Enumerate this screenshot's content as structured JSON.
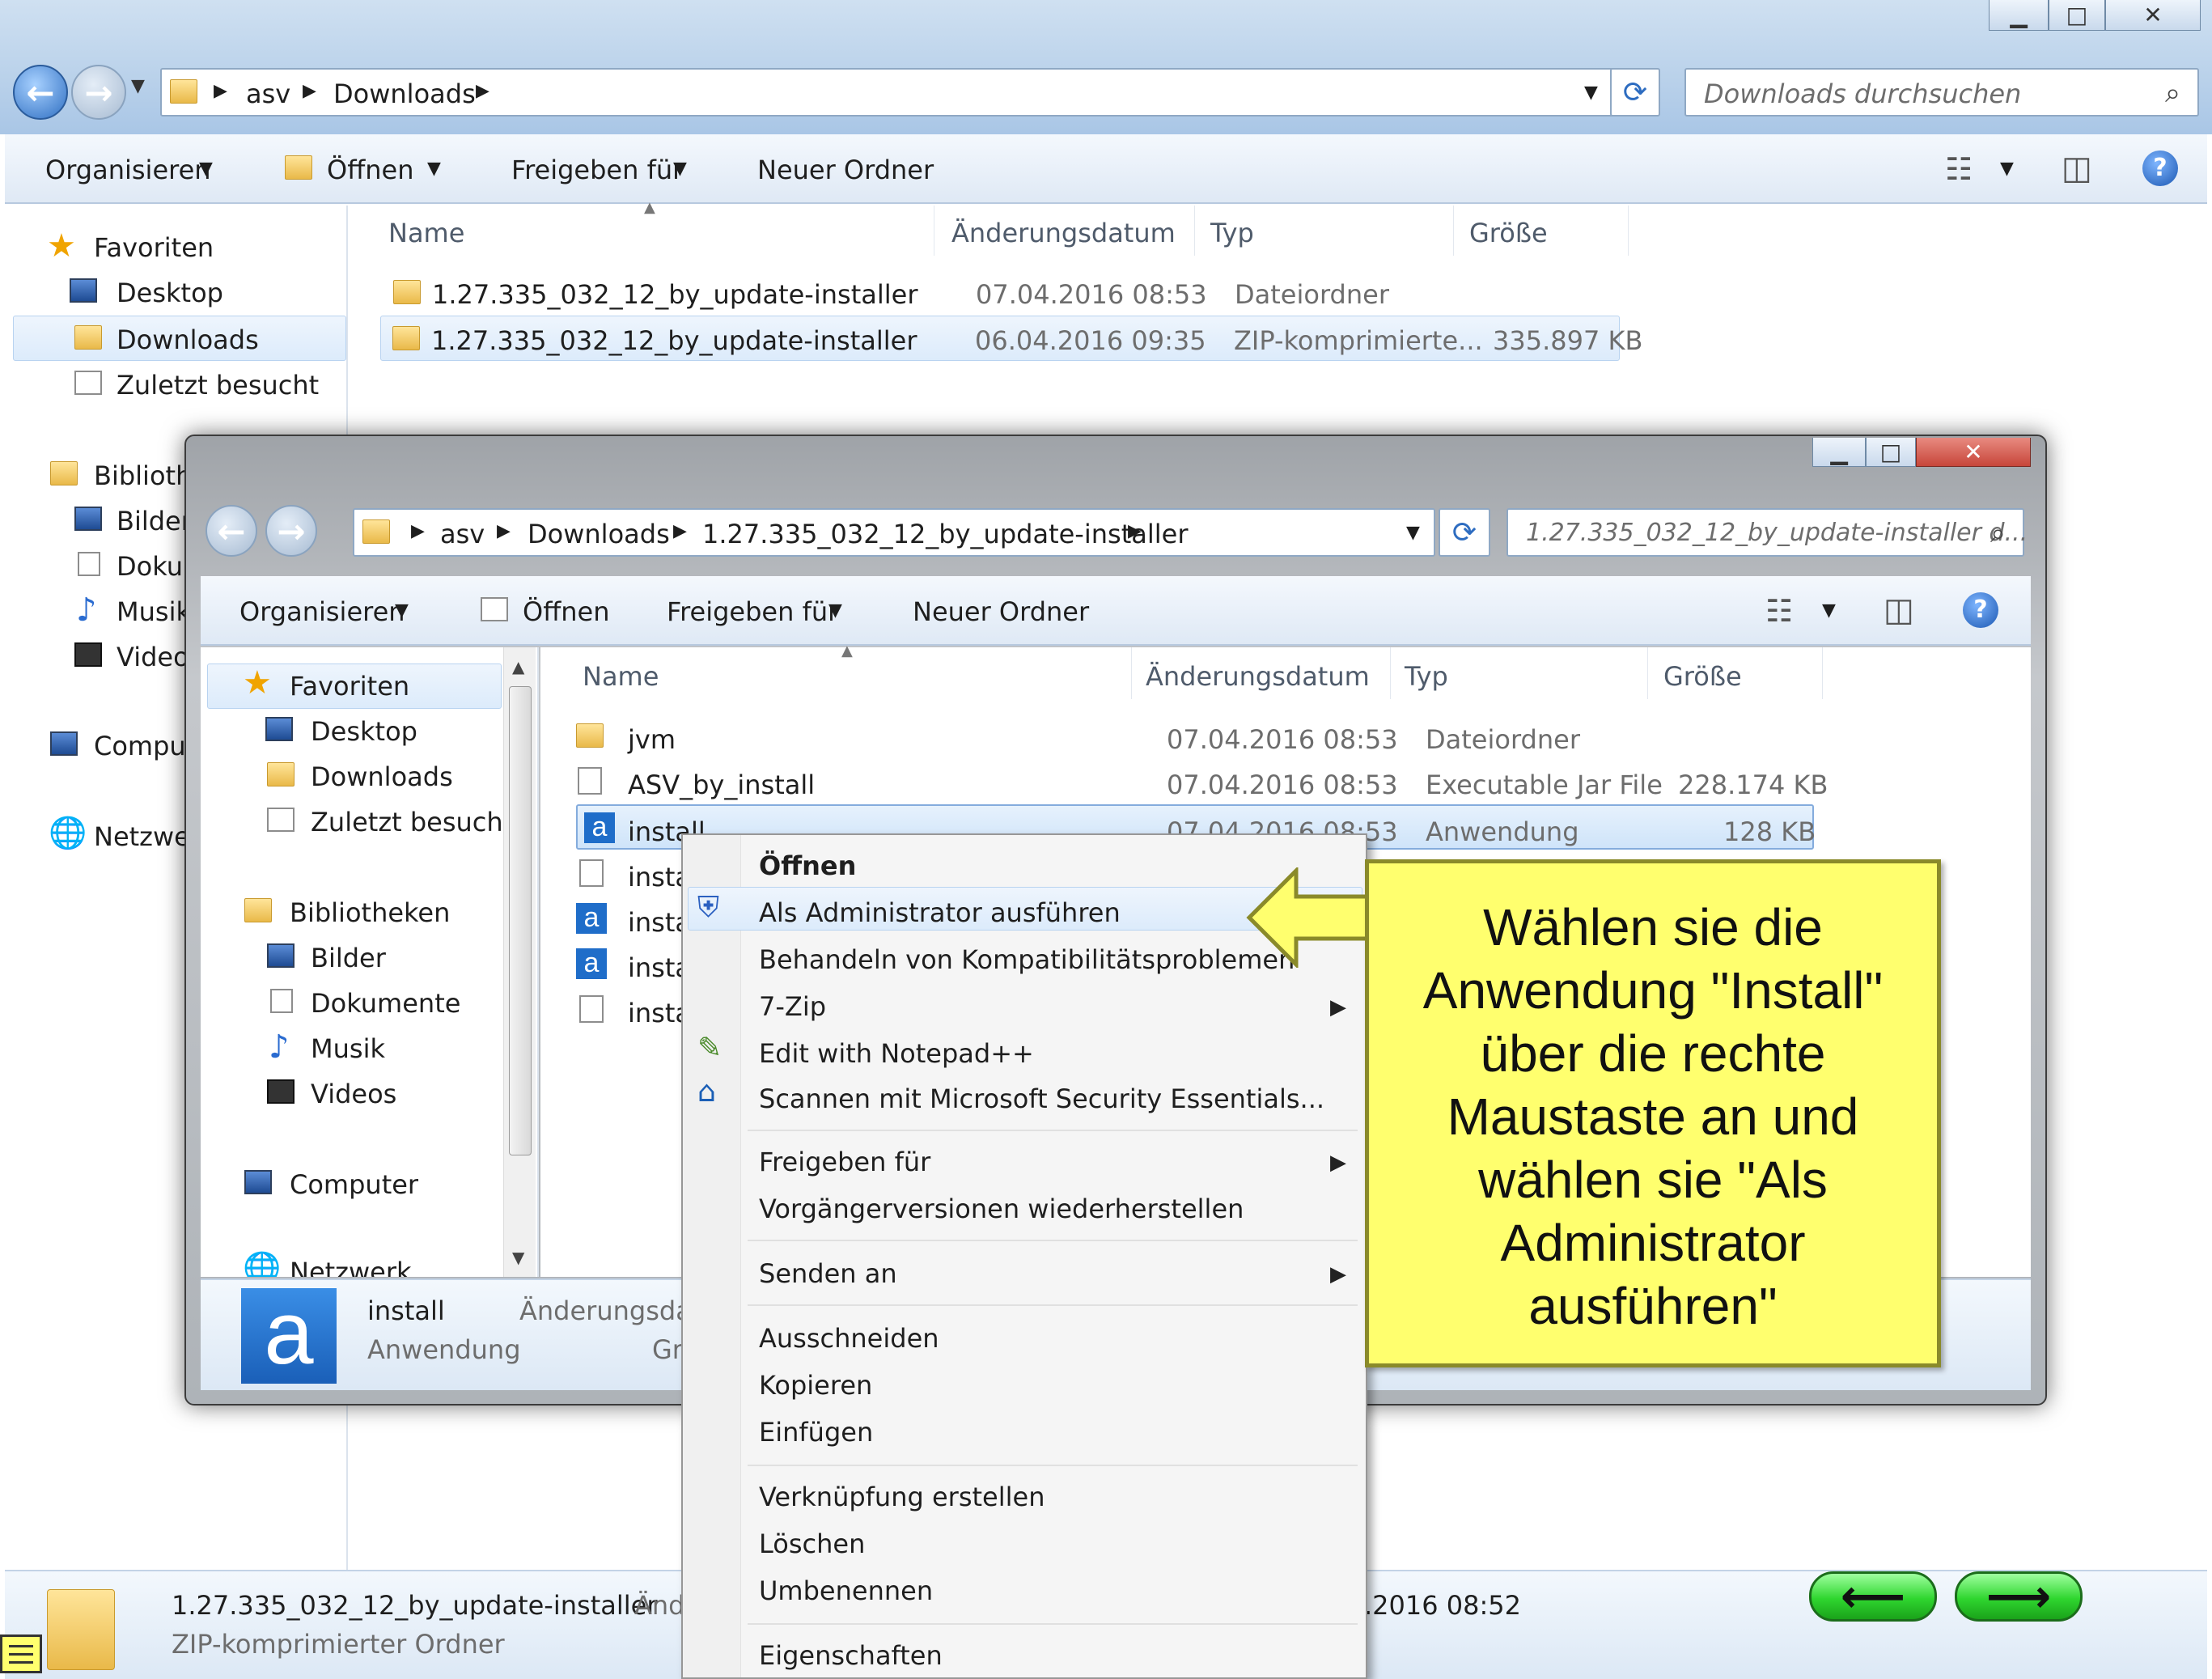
{
  "outer": {
    "breadcrumb": [
      "asv",
      "Downloads"
    ],
    "search_placeholder": "Downloads durchsuchen",
    "toolbar": {
      "organize": "Organisieren",
      "open": "Öffnen",
      "share": "Freigeben für",
      "new_folder": "Neuer Ordner"
    },
    "sidebar": {
      "favorites": "Favoriten",
      "desktop": "Desktop",
      "downloads": "Downloads",
      "recent": "Zuletzt besucht",
      "libraries": "Biblioth",
      "pictures": "Bilder",
      "documents": "Doku",
      "music": "Musik",
      "videos": "Video",
      "computer": "Compu",
      "network": "Netzwe"
    },
    "columns": {
      "name": "Name",
      "date": "Änderungsdatum",
      "type": "Typ",
      "size": "Größe"
    },
    "files": [
      {
        "name": "1.27.335_032_12_by_update-installer",
        "date": "07.04.2016 08:53",
        "type": "Dateiordner",
        "size": ""
      },
      {
        "name": "1.27.335_032_12_by_update-installer",
        "date": "06.04.2016 09:35",
        "type": "ZIP-komprimierte...",
        "size": "335.897 KB"
      }
    ],
    "details": {
      "name": "1.27.335_032_12_by_update-installer",
      "type": "ZIP-komprimierter Ordner",
      "date_label": "Änd",
      "date_value": ".2016 08:52"
    }
  },
  "inner": {
    "breadcrumb": [
      "asv",
      "Downloads",
      "1.27.335_032_12_by_update-installer"
    ],
    "search_placeholder": "1.27.335_032_12_by_update-installer d...",
    "toolbar": {
      "organize": "Organisieren",
      "open": "Öffnen",
      "share": "Freigeben für",
      "new_folder": "Neuer Ordner"
    },
    "sidebar": {
      "favorites": "Favoriten",
      "desktop": "Desktop",
      "downloads": "Downloads",
      "recent": "Zuletzt besucht",
      "libraries": "Bibliotheken",
      "pictures": "Bilder",
      "documents": "Dokumente",
      "music": "Musik",
      "videos": "Videos",
      "computer": "Computer",
      "network": "Netzwerk"
    },
    "columns": {
      "name": "Name",
      "date": "Änderungsdatum",
      "type": "Typ",
      "size": "Größe"
    },
    "files": [
      {
        "name": "jvm",
        "date": "07.04.2016 08:53",
        "type": "Dateiordner",
        "size": ""
      },
      {
        "name": "ASV_by_install",
        "date": "07.04.2016 08:53",
        "type": "Executable Jar File",
        "size": "228.174 KB"
      },
      {
        "name": "install",
        "date": "07.04.2016 08:53",
        "type": "Anwendung",
        "size": "128 KB"
      },
      {
        "name": "insta"
      },
      {
        "name": "insta"
      },
      {
        "name": "insta"
      },
      {
        "name": "insta"
      }
    ],
    "details": {
      "name": "install",
      "type": "Anwendung",
      "date_label": "Änderungsdat",
      "size_label": "Gr"
    }
  },
  "context_menu": {
    "open": "Öffnen",
    "run_as_admin": "Als Administrator ausführen",
    "compat": "Behandeln von Kompatibilitätsproblemen",
    "zip": "7-Zip",
    "notepad": "Edit with Notepad++",
    "scan": "Scannen mit Microsoft Security Essentials...",
    "share": "Freigeben für",
    "restore": "Vorgängerversionen wiederherstellen",
    "send_to": "Senden an",
    "cut": "Ausschneiden",
    "copy": "Kopieren",
    "paste": "Einfügen",
    "shortcut": "Verknüpfung erstellen",
    "delete": "Löschen",
    "rename": "Umbenennen",
    "properties": "Eigenschaften"
  },
  "callout": {
    "text": "Wählen sie die\nAnwendung \"Install\"\nüber die rechte\nMaustaste an und\nwählen sie \"Als\nAdministrator\nausführen\""
  },
  "nav_buttons": {
    "back": "⟵",
    "forward": "⟶"
  },
  "colors": {
    "callout_bg": "#ffff6e",
    "accent": "#3a78c9",
    "close_red": "#c7463a",
    "nav_green": "#2fd62f"
  }
}
